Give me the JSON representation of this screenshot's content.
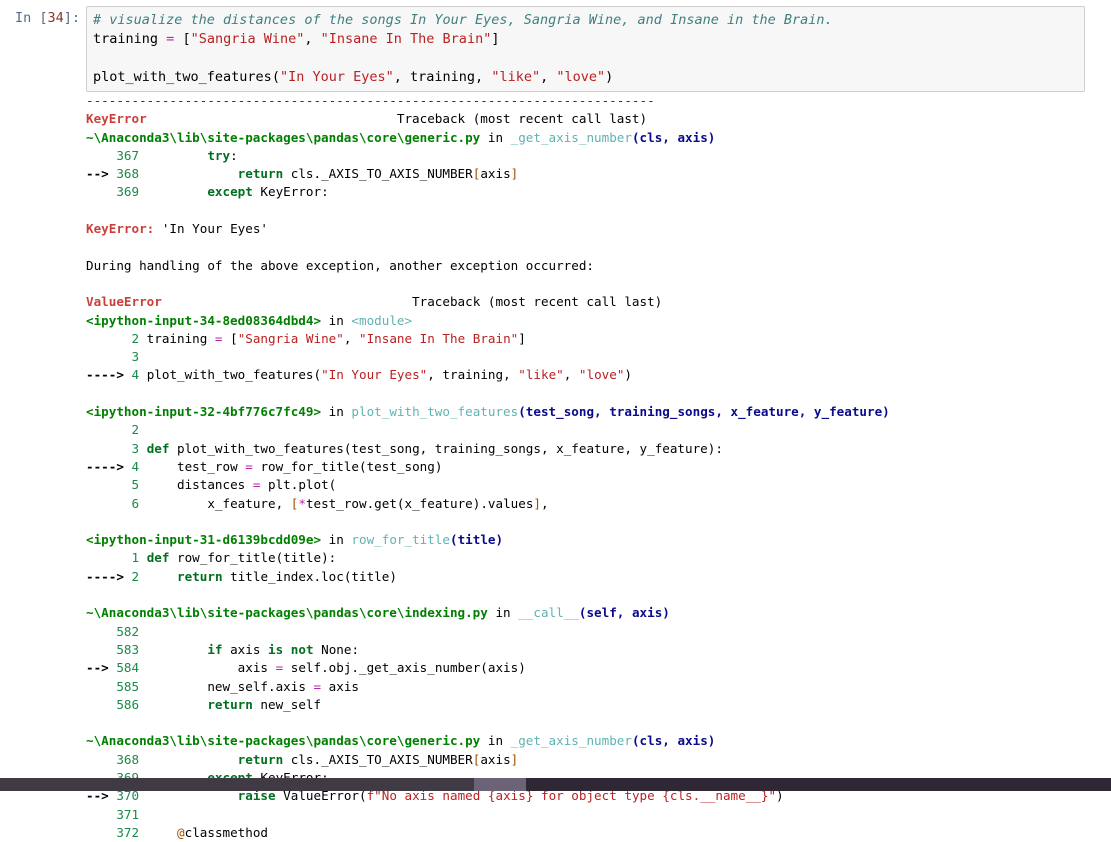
{
  "cell": {
    "prompt_label": "In [",
    "prompt_number": "34",
    "prompt_close": "]:",
    "code_lines": [
      "# visualize the distances of the songs In Your Eyes, Sangria Wine, and Insane in the Brain.",
      "training = [\"Sangria Wine\", \"Insane In The Brain\"]",
      "",
      "plot_with_two_features(\"In Your Eyes\", training, \"like\", \"love\")"
    ]
  },
  "traceback": {
    "separator": "---------------------------------------------------------------------------",
    "first_error": {
      "name": "KeyError",
      "header_right": "Traceback (most recent call last)",
      "frames": [
        {
          "location": "~\\Anaconda3\\lib\\site-packages\\pandas\\core\\generic.py",
          "in_word": "in",
          "function": "_get_axis_number",
          "args": "(cls, axis)",
          "lines": [
            {
              "marker": "",
              "number": "367",
              "code": "        try:"
            },
            {
              "marker": "-->",
              "number": "368",
              "code": "            return cls._AXIS_TO_AXIS_NUMBER[axis]"
            },
            {
              "marker": "",
              "number": "369",
              "code": "        except KeyError:"
            }
          ]
        }
      ],
      "message_name": "KeyError:",
      "message_value": " 'In Your Eyes'"
    },
    "chained_note": "During handling of the above exception, another exception occurred:",
    "second_error": {
      "name": "ValueError",
      "header_right": "Traceback (most recent call last)",
      "frames": [
        {
          "location": "<ipython-input-34-8ed08364dbd4>",
          "in_word": "in",
          "function": "<module>",
          "args": "",
          "lines": [
            {
              "marker": "",
              "number": "2",
              "code": "training = [\"Sangria Wine\", \"Insane In The Brain\"]"
            },
            {
              "marker": "",
              "number": "3",
              "code": ""
            },
            {
              "marker": "---->",
              "number": "4",
              "code": "plot_with_two_features(\"In Your Eyes\", training, \"like\", \"love\")"
            }
          ]
        },
        {
          "location": "<ipython-input-32-4bf776c7fc49>",
          "in_word": "in",
          "function": "plot_with_two_features",
          "args": "(test_song, training_songs, x_feature, y_feature)",
          "lines": [
            {
              "marker": "",
              "number": "2",
              "code": ""
            },
            {
              "marker": "",
              "number": "3",
              "code": "def plot_with_two_features(test_song, training_songs, x_feature, y_feature):"
            },
            {
              "marker": "---->",
              "number": "4",
              "code": "    test_row = row_for_title(test_song)"
            },
            {
              "marker": "",
              "number": "5",
              "code": "    distances = plt.plot("
            },
            {
              "marker": "",
              "number": "6",
              "code": "        x_feature, [*test_row.get(x_feature).values],"
            }
          ]
        },
        {
          "location": "<ipython-input-31-d6139bcdd09e>",
          "in_word": "in",
          "function": "row_for_title",
          "args": "(title)",
          "lines": [
            {
              "marker": "",
              "number": "1",
              "code": "def row_for_title(title):"
            },
            {
              "marker": "---->",
              "number": "2",
              "code": "    return title_index.loc(title)"
            }
          ]
        },
        {
          "location": "~\\Anaconda3\\lib\\site-packages\\pandas\\core\\indexing.py",
          "in_word": "in",
          "function": "__call__",
          "args": "(self, axis)",
          "lines": [
            {
              "marker": "",
              "number": "582",
              "code": ""
            },
            {
              "marker": "",
              "number": "583",
              "code": "        if axis is not None:"
            },
            {
              "marker": "-->",
              "number": "584",
              "code": "            axis = self.obj._get_axis_number(axis)"
            },
            {
              "marker": "",
              "number": "585",
              "code": "        new_self.axis = axis"
            },
            {
              "marker": "",
              "number": "586",
              "code": "        return new_self"
            }
          ]
        },
        {
          "location": "~\\Anaconda3\\lib\\site-packages\\pandas\\core\\generic.py",
          "in_word": "in",
          "function": "_get_axis_number",
          "args": "(cls, axis)",
          "lines": [
            {
              "marker": "",
              "number": "368",
              "code": "            return cls._AXIS_TO_AXIS_NUMBER[axis]"
            },
            {
              "marker": "",
              "number": "369",
              "code": "        except KeyError:"
            },
            {
              "marker": "-->",
              "number": "370",
              "code": "            raise ValueError(f\"No axis named {axis} for object type {cls.__name__}\")"
            },
            {
              "marker": "",
              "number": "371",
              "code": ""
            },
            {
              "marker": "",
              "number": "372",
              "code": "    @classmethod"
            }
          ]
        }
      ]
    }
  },
  "scrollbar": {
    "orientation": "horizontal",
    "thumb_color": "#6d6376",
    "track_color": "#2f2834"
  }
}
